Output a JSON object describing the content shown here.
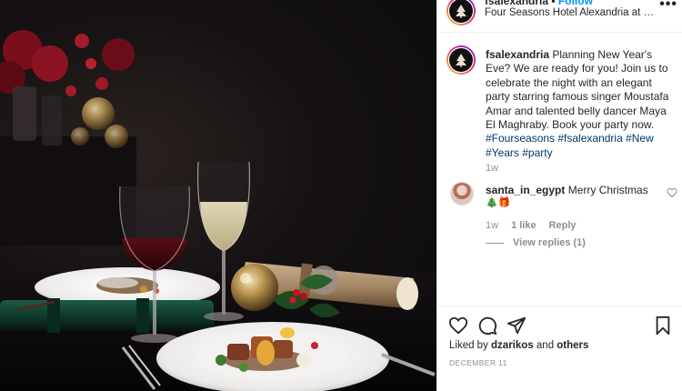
{
  "post": {
    "username": "fsalexandria",
    "follow_separator": " • ",
    "follow_label": "Follow",
    "location": "Four Seasons Hotel Alexandria at San Stef...",
    "more": "•••"
  },
  "caption": {
    "username": "fsalexandria",
    "text": " Planning New Year's Eve? We are ready for you! Join us to celebrate the night with an elegant party starring famous singer Moustafa Amar and talented belly dancer Maya El Maghraby. Book your party now. ",
    "hashtags": "#Fourseasons #fsalexandria #New #Years #party",
    "time": "1w"
  },
  "comment": {
    "username": "santa_in_egypt",
    "text": " Merry Christmas",
    "emoji": "🎄🎁",
    "time": "1w",
    "likes": "1 like",
    "reply": "Reply",
    "view_replies": "View replies (1)"
  },
  "footer": {
    "liked_by_prefix": "Liked by ",
    "liked_by_user": "dzarikos",
    "liked_by_middle": " and ",
    "liked_by_others": "others",
    "date": "DECEMBER 11"
  },
  "icons": {
    "like": "heart-icon",
    "comment": "comment-icon",
    "share": "share-icon",
    "save": "bookmark-icon",
    "comment_like": "heart-icon"
  },
  "colors": {
    "link": "#00376b",
    "follow": "#0095f6",
    "muted": "#8e8e8e"
  }
}
